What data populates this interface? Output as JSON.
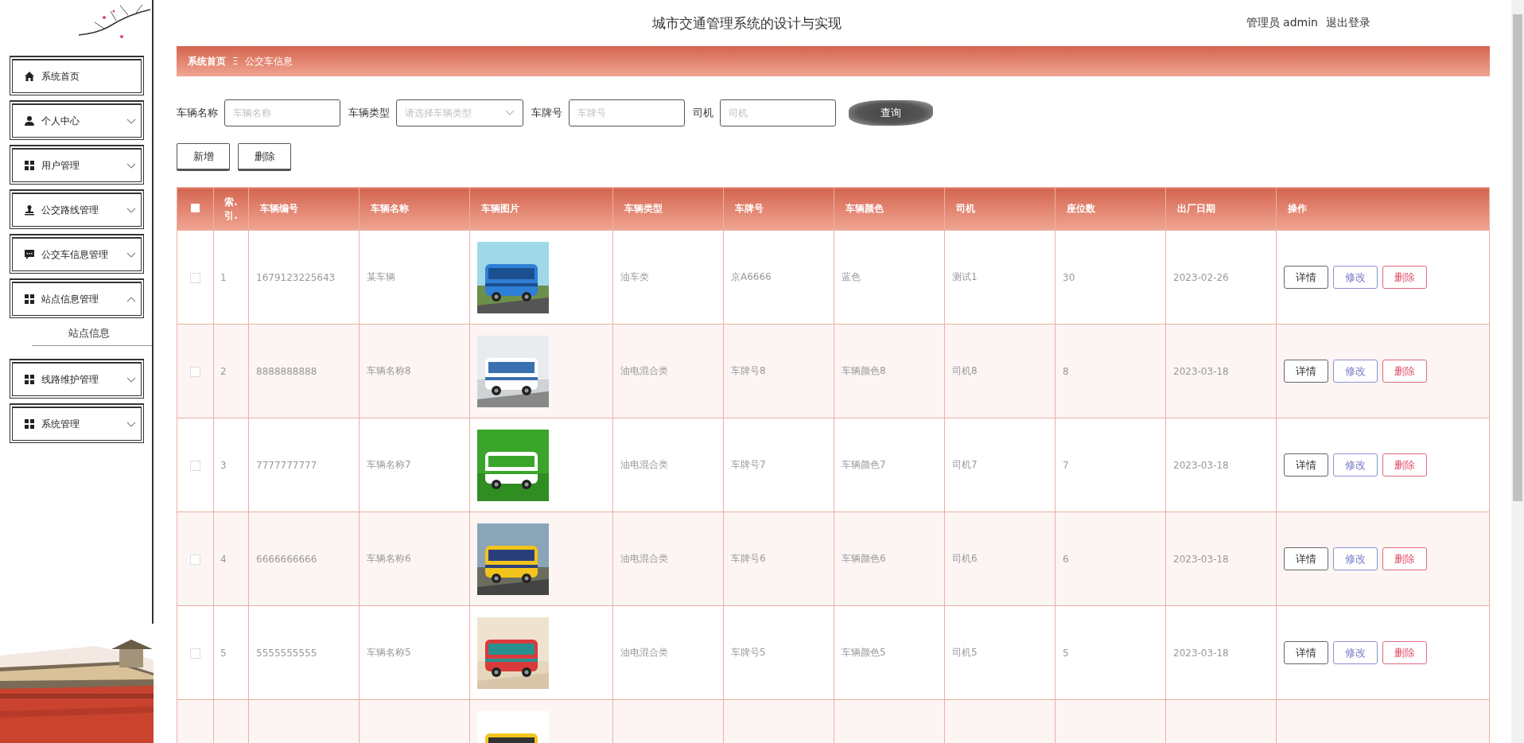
{
  "header": {
    "title": "城市交通管理系统的设计与实现",
    "user": "管理员 admin",
    "logout": "退出登录"
  },
  "sidebar": {
    "items": [
      {
        "label": "系统首页"
      },
      {
        "label": "个人中心",
        "expanded": false
      },
      {
        "label": "用户管理",
        "expanded": false
      },
      {
        "label": "公交路线管理",
        "expanded": false
      },
      {
        "label": "公交车信息管理",
        "expanded": false
      },
      {
        "label": "站点信息管理",
        "expanded": true,
        "children": [
          {
            "label": "站点信息"
          }
        ]
      },
      {
        "label": "线路维护管理",
        "expanded": false
      },
      {
        "label": "系统管理",
        "expanded": false
      }
    ]
  },
  "breadcrumb": {
    "items": [
      "系统首页",
      "公交车信息"
    ],
    "separator": "Ξ"
  },
  "search": {
    "fields": [
      {
        "label": "车辆名称",
        "placeholder": "车辆名称",
        "kind": "text"
      },
      {
        "label": "车辆类型",
        "placeholder": "请选择车辆类型",
        "kind": "select"
      },
      {
        "label": "车牌号",
        "placeholder": "车牌号",
        "kind": "text"
      },
      {
        "label": "司机",
        "placeholder": "司机",
        "kind": "text"
      }
    ],
    "button": "查询"
  },
  "actions": [
    "新增",
    "删除"
  ],
  "table": {
    "all_selected": false,
    "columns": [
      "索.引.",
      "车辆编号",
      "车辆名称",
      "车辆图片",
      "车辆类型",
      "车牌号",
      "车辆颜色",
      "司机",
      "座位数",
      "出厂日期",
      "操作"
    ],
    "rows": [
      {
        "selected": false,
        "cells": [
          "1",
          "1679123225643",
          "某车辆",
          null,
          "油车类",
          "京A6666",
          "蓝色",
          "测试1",
          "30",
          "2023-02-26"
        ],
        "buttons": [
          {
            "label": "详情",
            "kind": "detail"
          },
          {
            "label": "修改",
            "kind": "edit"
          },
          {
            "label": "删除",
            "kind": "delete"
          }
        ]
      },
      {
        "selected": false,
        "cells": [
          "2",
          "8888888888",
          "车辆名称8",
          null,
          "油电混合类",
          "车牌号8",
          "车辆颜色8",
          "司机8",
          "8",
          "2023-03-18"
        ],
        "buttons": [
          {
            "label": "详情",
            "kind": "detail"
          },
          {
            "label": "修改",
            "kind": "edit"
          },
          {
            "label": "删除",
            "kind": "delete"
          }
        ]
      },
      {
        "selected": false,
        "cells": [
          "3",
          "7777777777",
          "车辆名称7",
          null,
          "油电混合类",
          "车牌号7",
          "车辆颜色7",
          "司机7",
          "7",
          "2023-03-18"
        ],
        "buttons": [
          {
            "label": "详情",
            "kind": "detail"
          },
          {
            "label": "修改",
            "kind": "edit"
          },
          {
            "label": "删除",
            "kind": "delete"
          }
        ]
      },
      {
        "selected": false,
        "cells": [
          "4",
          "6666666666",
          "车辆名称6",
          null,
          "油电混合类",
          "车牌号6",
          "车辆颜色6",
          "司机6",
          "6",
          "2023-03-18"
        ],
        "buttons": [
          {
            "label": "详情",
            "kind": "detail"
          },
          {
            "label": "修改",
            "kind": "edit"
          },
          {
            "label": "删除",
            "kind": "delete"
          }
        ]
      },
      {
        "selected": false,
        "cells": [
          "5",
          "5555555555",
          "车辆名称5",
          null,
          "油电混合类",
          "车牌号5",
          "车辆颜色5",
          "司机5",
          "5",
          "2023-03-18"
        ],
        "buttons": [
          {
            "label": "详情",
            "kind": "detail"
          },
          {
            "label": "修改",
            "kind": "edit"
          },
          {
            "label": "删除",
            "kind": "delete"
          }
        ]
      },
      {
        "cells": [
          null,
          null,
          null,
          null,
          null,
          null,
          null,
          null,
          null,
          null
        ]
      }
    ]
  }
}
